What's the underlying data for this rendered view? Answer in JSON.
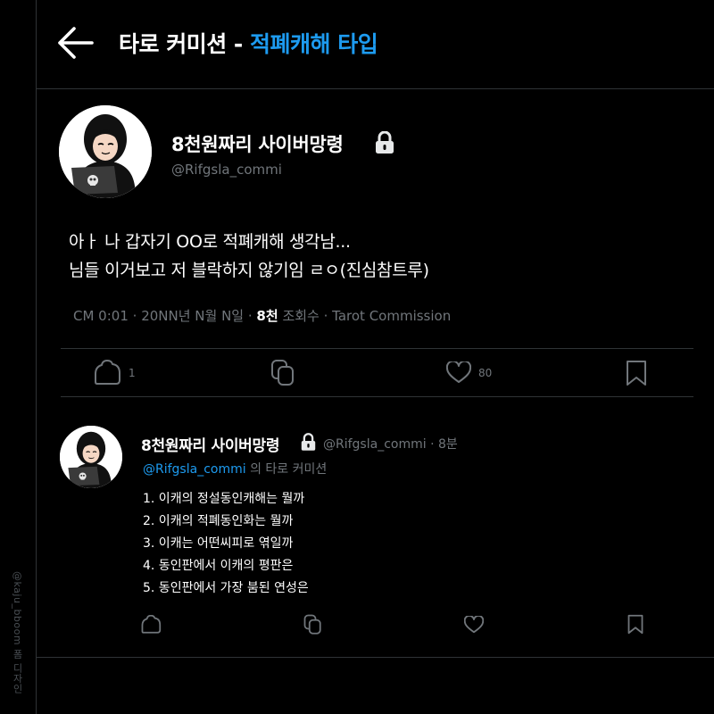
{
  "watermark": "@kaju_bboom 폼 디자인",
  "header": {
    "title_main": "타로 커미션 - ",
    "title_accent": "적폐캐해 타입",
    "accent_color": "#1d9bf0",
    "back_icon": "arrow-left-icon"
  },
  "post": {
    "display_name": "8천원짜리 사이버망령",
    "handle": "@Rifgsla_commi",
    "lines": [
      "아ㅏ 나 갑자기 OO로 적폐캐해 생각남...",
      "님들 이거보고 저 블락하지 않기임 ㄹㅇ(진심참트루)"
    ],
    "meta_time": "CM 0:01",
    "meta_date": "20NN년 N월 N일",
    "meta_views": "8천",
    "meta_views_label": "조회수",
    "meta_source": "Tarot Commission",
    "actions": {
      "reply_count": "1",
      "like_count": "80"
    }
  },
  "reply": {
    "display_name": "8천원짜리 사이버망령",
    "handle": "@Rifgsla_commi",
    "time": "8분",
    "reply_to_mention": "@Rifgsla_commi",
    "reply_to_suffix": " 의 타로 커미션",
    "items": [
      "1. 이캐의 정설동인캐해는 뭘까",
      "2. 이캐의 적폐동인화는 뭘까",
      "3. 이캐는 어떤씨피로 엮일까",
      "4. 동인판에서 이캐의 평판은",
      "5. 동인판에서 가장 붐된 연성은"
    ]
  }
}
